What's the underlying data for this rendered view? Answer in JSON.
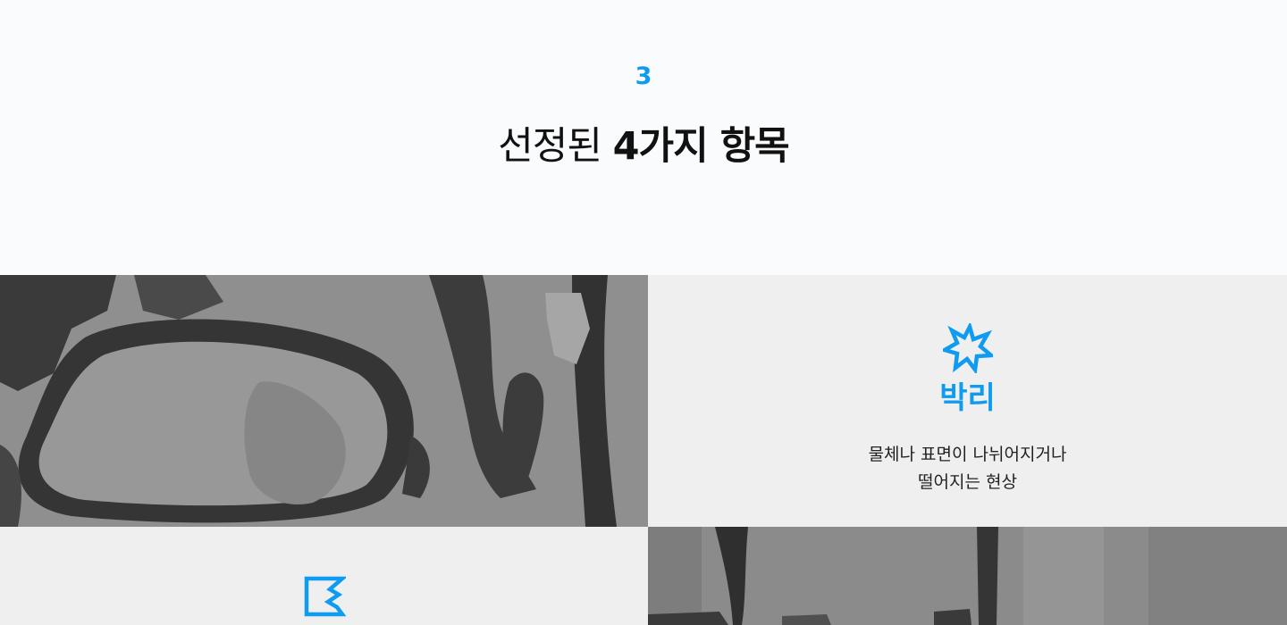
{
  "header": {
    "step_number": "3",
    "title_light": "선정된",
    "title_bold": "4가지 항목"
  },
  "items": [
    {
      "title": "박리",
      "description_lines": [
        "물체나 표면이 나뉘어지거나",
        "떨어지는 현상"
      ],
      "icon": "starburst-icon"
    },
    {
      "title": "",
      "icon": "crack-icon"
    }
  ],
  "colors": {
    "accent": "#0e9bf0",
    "background": "#fafbfc",
    "tile_background": "#efefef"
  }
}
